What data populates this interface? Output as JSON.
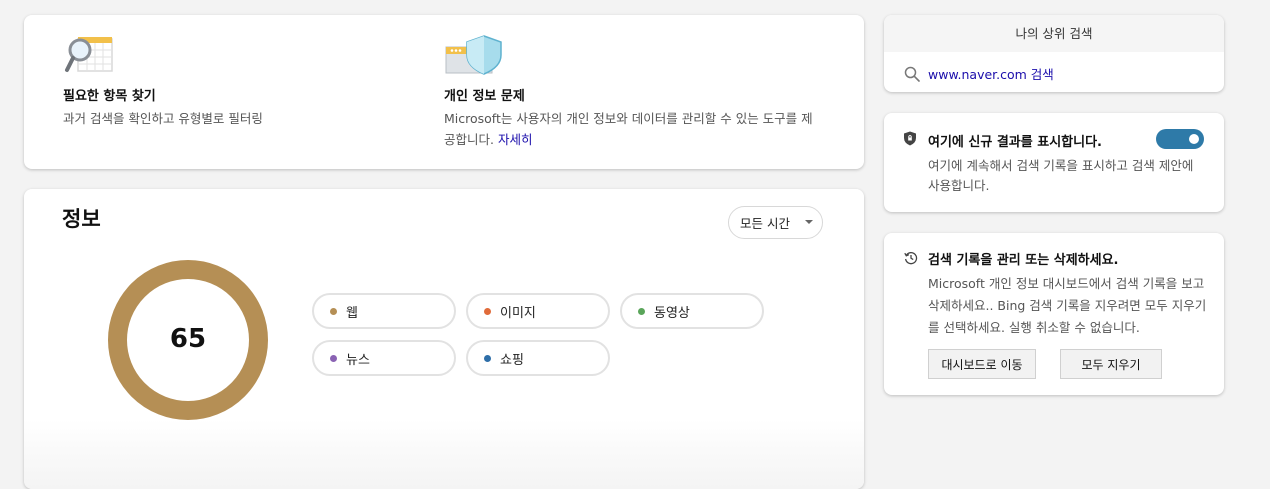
{
  "features": [
    {
      "title": "필요한 항목 찾기",
      "desc": "과거 검색을 확인하고 유형별로 필터링",
      "icon": "magnifier-calendar-icon"
    },
    {
      "title": "개인 정보 문제",
      "desc": "Microsoft는 사용자의 개인 정보와 데이터를 관리할 수 있는 도구를 제공합니다.",
      "link": "자세히",
      "icon": "shield-password-icon"
    }
  ],
  "info": {
    "title": "정보",
    "time_filter": "모든 시간",
    "count": "65",
    "ring_color": "#b58f55",
    "categories": [
      {
        "label": "웹",
        "color": "#b58f55"
      },
      {
        "label": "이미지",
        "color": "#e06b3a"
      },
      {
        "label": "동영상",
        "color": "#5aa55a"
      },
      {
        "label": "뉴스",
        "color": "#8a62b3"
      },
      {
        "label": "쇼핑",
        "color": "#2e6ea8"
      }
    ]
  },
  "top_searches": {
    "header": "나의 상위 검색",
    "items": [
      "www.naver.com 검색"
    ]
  },
  "show_results": {
    "title": "여기에 신규 결과를 표시합니다.",
    "desc": "여기에 계속해서 검색 기록을 표시하고 검색 제안에 사용합니다.",
    "toggle_on": true,
    "toggle_color": "#2e7aa8"
  },
  "manage": {
    "title": "검색 기록을 관리 또는 삭제하세요.",
    "desc": "Microsoft 개인 정보 대시보드에서 검색 기록을 보고 삭제하세요.. Bing 검색 기록을 지우려면 모두 지우기를 선택하세요. 실행 취소할 수 없습니다.",
    "dashboard_button": "대시보드로 이동",
    "clear_button": "모두 지우기"
  }
}
